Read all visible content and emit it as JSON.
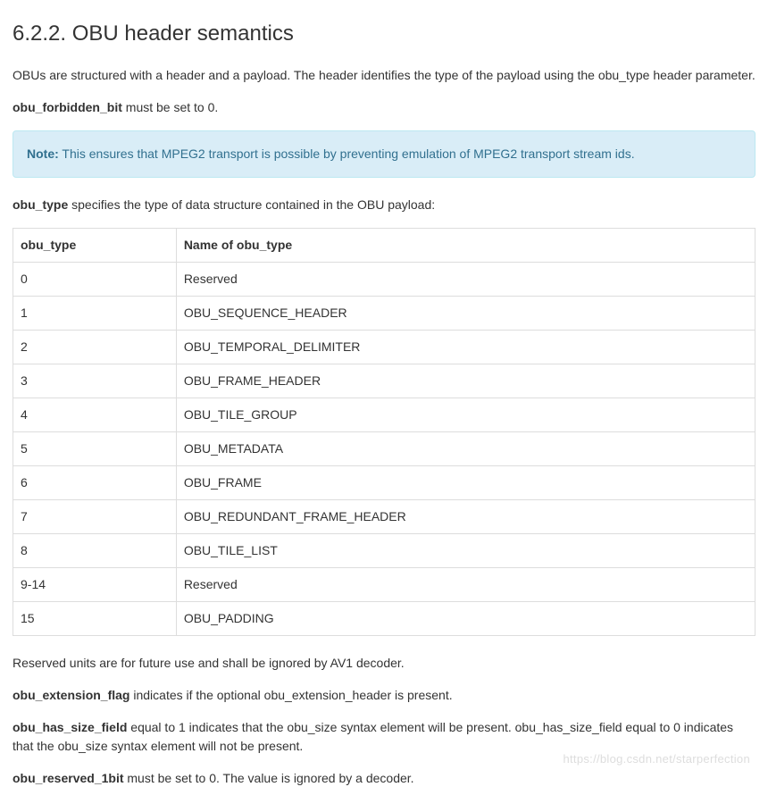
{
  "heading": "6.2.2. OBU header semantics",
  "intro": "OBUs are structured with a header and a payload. The header identifies the type of the payload using the obu_type header parameter.",
  "forbidden": {
    "term": "obu_forbidden_bit",
    "text": " must be set to 0."
  },
  "note": {
    "label": "Note:",
    "text": " This ensures that MPEG2 transport is possible by preventing emulation of MPEG2 transport stream ids."
  },
  "obutype_intro": {
    "term": "obu_type",
    "text": " specifies the type of data structure contained in the OBU payload:"
  },
  "table": {
    "headers": [
      "obu_type",
      "Name of obu_type"
    ],
    "rows": [
      [
        "0",
        "Reserved"
      ],
      [
        "1",
        "OBU_SEQUENCE_HEADER"
      ],
      [
        "2",
        "OBU_TEMPORAL_DELIMITER"
      ],
      [
        "3",
        "OBU_FRAME_HEADER"
      ],
      [
        "4",
        "OBU_TILE_GROUP"
      ],
      [
        "5",
        "OBU_METADATA"
      ],
      [
        "6",
        "OBU_FRAME"
      ],
      [
        "7",
        "OBU_REDUNDANT_FRAME_HEADER"
      ],
      [
        "8",
        "OBU_TILE_LIST"
      ],
      [
        "9-14",
        "Reserved"
      ],
      [
        "15",
        "OBU_PADDING"
      ]
    ]
  },
  "reserved_note": "Reserved units are for future use and shall be ignored by AV1 decoder.",
  "ext_flag": {
    "term": "obu_extension_flag",
    "text": " indicates if the optional obu_extension_header is present."
  },
  "has_size": {
    "term": "obu_has_size_field",
    "text": " equal to 1 indicates that the obu_size syntax element will be present. obu_has_size_field equal to 0 indicates that the obu_size syntax element will not be present."
  },
  "reserved_1bit": {
    "term": "obu_reserved_1bit",
    "text": " must be set to 0. The value is ignored by a decoder."
  },
  "watermark": "https://blog.csdn.net/starperfection"
}
